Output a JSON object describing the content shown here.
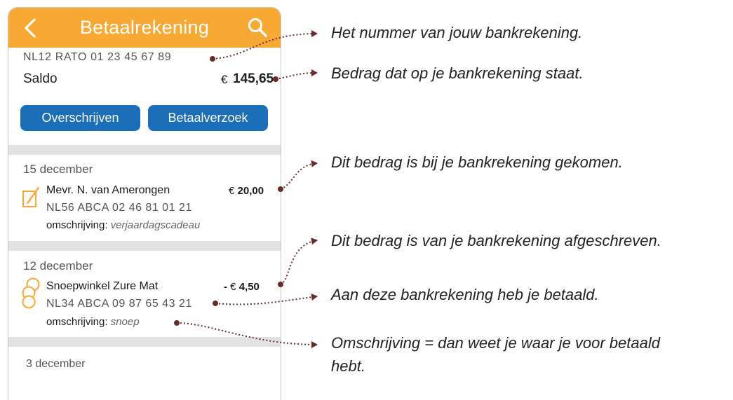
{
  "app": {
    "title": "Betaalrekening",
    "back_icon": "chevron-left-icon",
    "search_icon": "search-icon",
    "accent": "#f7a934",
    "button_color": "#1a6fb8"
  },
  "account": {
    "number": "NL12 RATO 01 23 45 67 89",
    "saldo_label": "Saldo",
    "currency": "€",
    "saldo": "145,65"
  },
  "actions": {
    "transfer": "Overschrijven",
    "request": "Betaalverzoek"
  },
  "transactions": [
    {
      "date": "15 december",
      "icon": "edit-note-icon",
      "name": "Mevr. N. van Amerongen",
      "sign": "",
      "currency": "€",
      "amount": "20,00",
      "iban": "NL56 ABCA 02 46 81 01 21",
      "desc_label": "omschrijving:",
      "desc": "verjaardagscadeau"
    },
    {
      "date": "12 december",
      "icon": "coins-icon",
      "name": "Snoepwinkel Zure Mat",
      "sign": "-",
      "currency": "€",
      "amount": "4,50",
      "iban": "NL34 ABCA 09 87 65 43 21",
      "desc_label": "omschrijving:",
      "desc": "snoep"
    },
    {
      "date": "3 december"
    }
  ],
  "annotations": [
    "Het nummer van jouw bankrekening.",
    "Bedrag dat op je bankrekening staat.",
    "Dit bedrag is bij je bankrekening gekomen.",
    "Dit bedrag is van je bankrekening afgeschreven.",
    "Aan deze bankrekening heb je betaald.",
    "Omschrijving = dan weet je waar je voor betaald",
    "hebt."
  ],
  "annotation_color": "#6b2a2a"
}
